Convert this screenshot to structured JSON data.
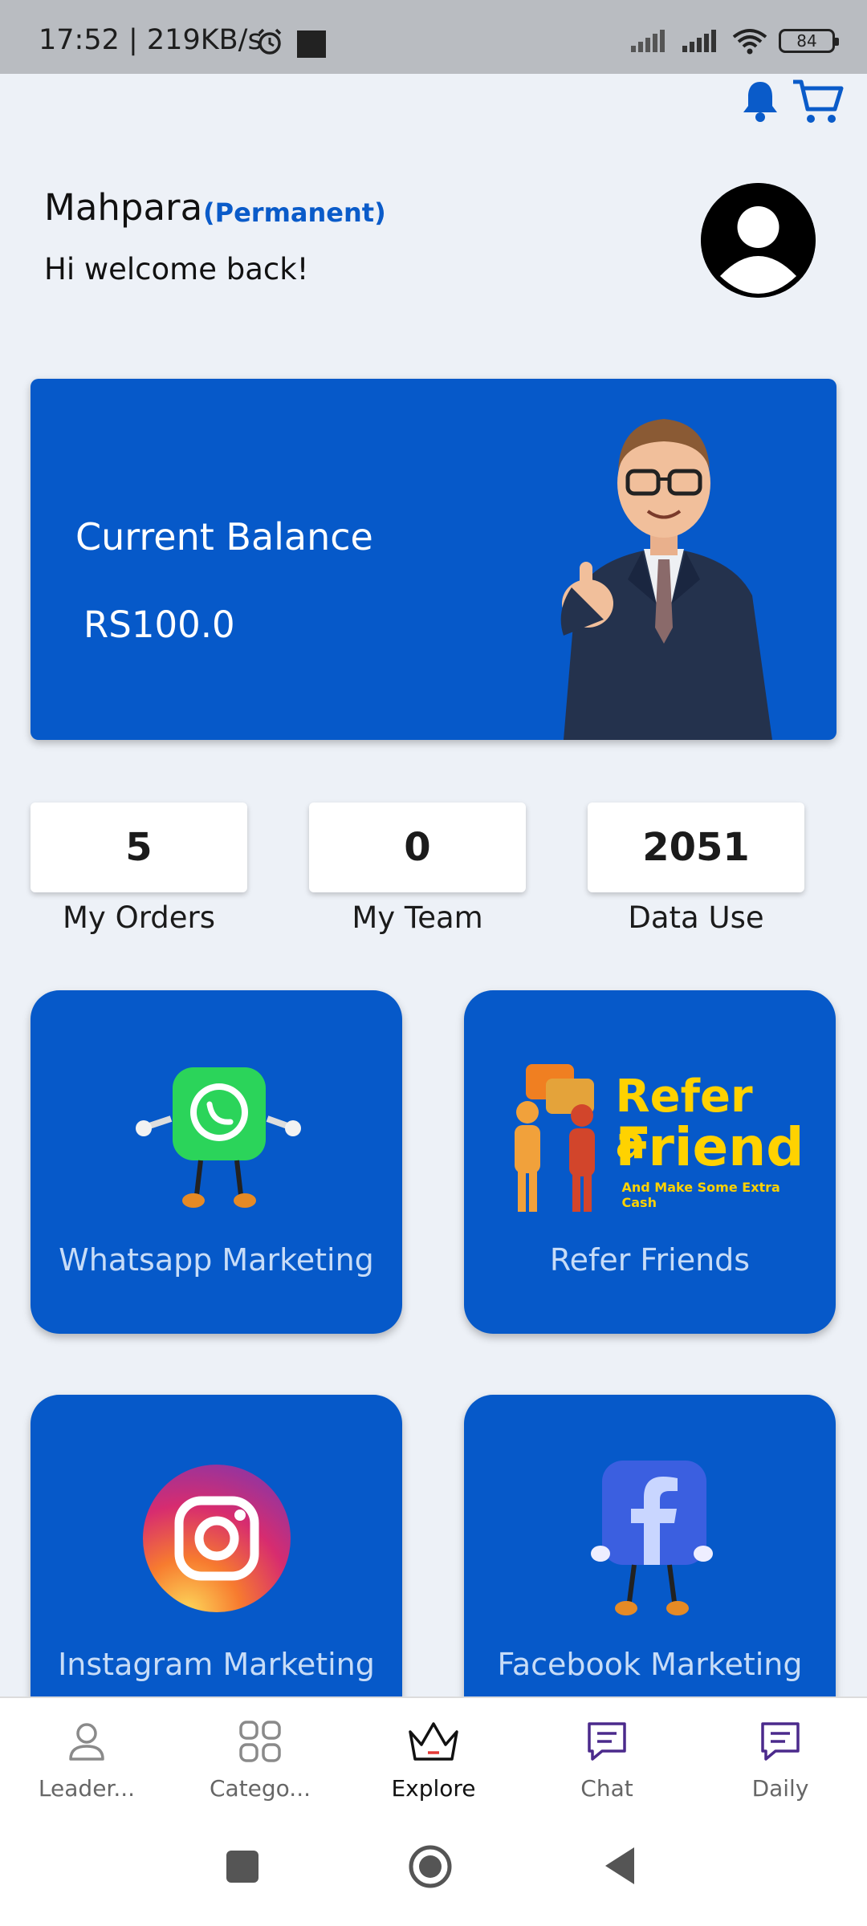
{
  "status_bar": {
    "time_speed": "17:52 | 219KB/s",
    "battery": "84"
  },
  "header": {
    "user_name": "Mahpara",
    "user_status": "(Permanent)",
    "welcome": "Hi welcome back!"
  },
  "balance": {
    "title": "Current Balance",
    "amount": "RS100.0"
  },
  "stats": [
    {
      "value": "5",
      "label": "My Orders"
    },
    {
      "value": "0",
      "label": "My Team"
    },
    {
      "value": "2051",
      "label": "Data Use"
    }
  ],
  "tiles": [
    {
      "label": "Whatsapp Marketing",
      "icon": "whatsapp-mascot-icon"
    },
    {
      "label": "Refer Friends",
      "icon": "refer-friend-banner",
      "banner_line1": "Refer a",
      "banner_line2": "Friend",
      "banner_sub": "And Make Some Extra Cash"
    },
    {
      "label": "Instagram Marketing",
      "icon": "instagram-icon"
    },
    {
      "label": "Facebook Marketing",
      "icon": "facebook-mascot-icon"
    }
  ],
  "bottom_nav": [
    {
      "label": "Leader...",
      "icon": "person-icon"
    },
    {
      "label": "Catego...",
      "icon": "category-icon"
    },
    {
      "label": "Explore",
      "icon": "crown-icon",
      "active": true
    },
    {
      "label": "Chat",
      "icon": "chat-icon"
    },
    {
      "label": "Daily",
      "icon": "chat-icon"
    }
  ],
  "colors": {
    "primary": "#0659c9",
    "background": "#edf1f7",
    "accent_text": "#0a5bc9"
  }
}
